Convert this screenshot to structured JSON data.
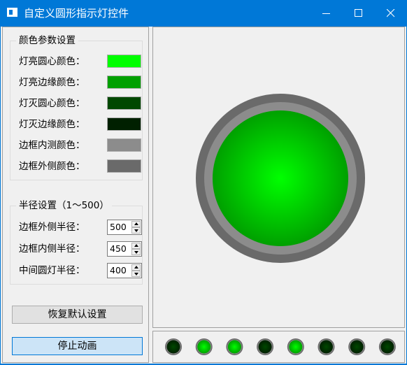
{
  "window": {
    "title": "自定义圆形指示灯控件",
    "accent_color": "#0078d7",
    "controls": [
      "minimize-icon",
      "maximize-icon",
      "close-icon"
    ]
  },
  "color_group": {
    "title": "颜色参数设置",
    "rows": [
      {
        "label": "灯亮圆心颜色：",
        "color": "#00ff00"
      },
      {
        "label": "灯亮边缘颜色：",
        "color": "#00a000"
      },
      {
        "label": "灯灭圆心颜色：",
        "color": "#004800"
      },
      {
        "label": "灯灭边缘颜色：",
        "color": "#002000"
      },
      {
        "label": "边框内测颜色：",
        "color": "#8c8c8c"
      },
      {
        "label": "边框外侧颜色：",
        "color": "#6a6a6a"
      }
    ]
  },
  "radius_group": {
    "title": "半径设置（1～500）",
    "rows": [
      {
        "label": "边框外侧半径：",
        "value": "500"
      },
      {
        "label": "边框内侧半径：",
        "value": "450"
      },
      {
        "label": "中间圆灯半径：",
        "value": "400"
      }
    ]
  },
  "buttons": {
    "reset_label": "恢复默认设置",
    "stop_label": "停止动画"
  },
  "big_light": {
    "state": "on"
  },
  "small_lights": [
    "off",
    "on",
    "on",
    "off",
    "on",
    "off",
    "off",
    "off"
  ]
}
